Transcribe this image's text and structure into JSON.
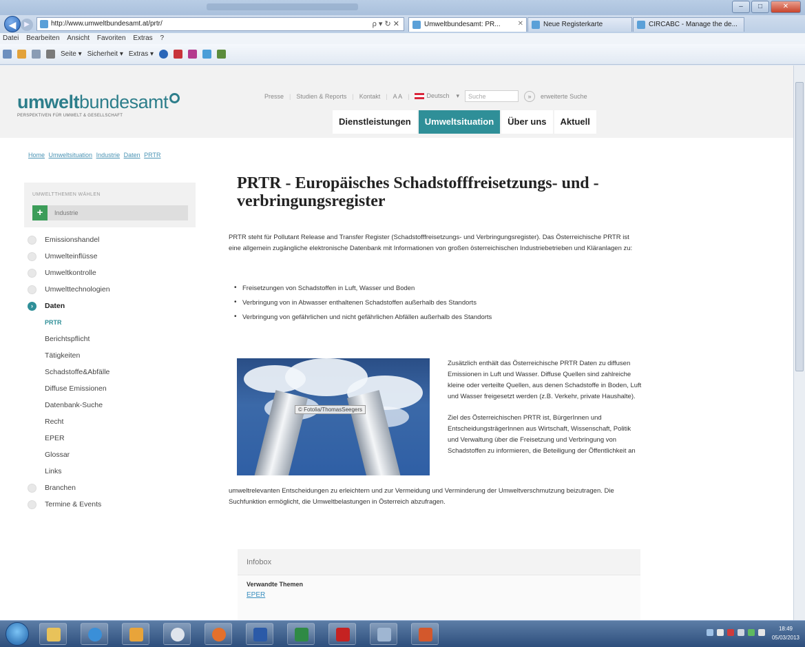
{
  "browser": {
    "address": "http://www.umweltbundesamt.at/prtr/",
    "address_controls": "ρ ▾ ↻ ✕",
    "tabs": [
      {
        "label": "Umweltbundesamt: PR..."
      },
      {
        "label": "Neue Registerkarte"
      },
      {
        "label": "CIRCABC - Manage the de..."
      }
    ],
    "menu": [
      "Datei",
      "Bearbeiten",
      "Ansicht",
      "Favoriten",
      "Extras",
      "?"
    ],
    "commands": [
      "Seite ▾",
      "Sicherheit ▾",
      "Extras ▾"
    ],
    "window_buttons": {
      "minimize": "–",
      "maximize": "□",
      "close": "✕"
    }
  },
  "header": {
    "logo_bold": "umwelt",
    "logo_rest": "bundesamt",
    "tagline": "PERSPEKTIVEN FÜR UMWELT & GESELLSCHAFT",
    "utility_links": [
      "Presse",
      "Studien & Reports",
      "Kontakt",
      "A A"
    ],
    "language": "Deutsch",
    "search_placeholder": "Suche",
    "search_go": "»",
    "advanced_search": "erweiterte Suche",
    "nav": [
      {
        "label": "Dienstleistungen",
        "active": false
      },
      {
        "label": "Umweltsituation",
        "active": true
      },
      {
        "label": "Über uns",
        "active": false
      },
      {
        "label": "Aktuell",
        "active": false
      }
    ]
  },
  "breadcrumb": [
    "Home",
    "Umweltsituation",
    "Industrie",
    "Daten",
    "PRTR"
  ],
  "sidebar": {
    "caption": "UMWELTTHEMEN WÄHLEN",
    "chip_label": "Industrie",
    "chip_icon": "+",
    "items": [
      {
        "label": "Emissionshandel"
      },
      {
        "label": "Umwelteinflüsse"
      },
      {
        "label": "Umweltkontrolle"
      },
      {
        "label": "Umwelttechnologien"
      }
    ],
    "active_item": {
      "label": "Daten",
      "icon": "›"
    },
    "sub_items": [
      {
        "label": "PRTR"
      },
      {
        "label": "Berichtspflicht"
      },
      {
        "label": "Tätigkeiten"
      },
      {
        "label": "Schadstoffe&Abfälle"
      },
      {
        "label": "Diffuse Emissionen"
      },
      {
        "label": "Datenbank-Suche"
      },
      {
        "label": "Recht"
      },
      {
        "label": "EPER"
      },
      {
        "label": "Glossar"
      },
      {
        "label": "Links"
      }
    ],
    "bottom_items": [
      {
        "label": "Branchen"
      },
      {
        "label": "Termine & Events"
      }
    ]
  },
  "content": {
    "title": "PRTR - Europäisches Schadstofffreisetzungs- und -verbringungsregister",
    "intro": "PRTR steht für Pollutant Release and Transfer Register (Schadstofffreisetzungs- und Verbringungsregister). Das Österreichische PRTR ist eine allgemein zugängliche elektronische Datenbank mit Informationen von großen österreichischen Industriebetrieben und Kläranlagen zu:",
    "bullets": [
      "Freisetzungen von Schadstoffen in Luft, Wasser und Boden",
      "Verbringung von in Abwasser enthaltenen Schadstoffen außerhalb des Standorts",
      "Verbringung von gefährlichen und nicht gefährlichen Abfällen außerhalb des Standorts"
    ],
    "photo_credit": "© Fotolia/ThomasSeegers",
    "side_paragraph_1": "Zusätzlich enthält das Österreichische PRTR Daten zu diffusen Emissionen in Luft und Wasser. Diffuse Quellen sind zahlreiche kleine oder verteilte Quellen, aus denen Schadstoffe in Boden, Luft und Wasser freigesetzt werden (z.B. Verkehr, private Haushalte).",
    "side_paragraph_2": "Ziel des Österreichischen PRTR ist, BürgerInnen und EntscheidungsträgerInnen aus Wirtschaft, Wissenschaft, Politik und Verwaltung über die Freisetzung und Verbringung von Schadstoffen zu informieren, die Beteiligung der Öffentlichkeit an",
    "full_paragraph": "umweltrelevanten Entscheidungen zu erleichtern und zur Vermeidung und Verminderung der Umweltverschmutzung beizutragen. Die Suchfunktion ermöglicht, die Umweltbelastungen in Österreich abzufragen."
  },
  "infobox": {
    "title": "Infobox",
    "label": "Verwandte Themen",
    "link": "EPER"
  },
  "taskbar": {
    "clock_time": "18:49",
    "clock_date": "05/03/2013",
    "apps": [
      "explorer",
      "internet-explorer",
      "outlook",
      "security",
      "firefox",
      "word",
      "excel",
      "acrobat",
      "notepad",
      "powerpoint"
    ]
  }
}
